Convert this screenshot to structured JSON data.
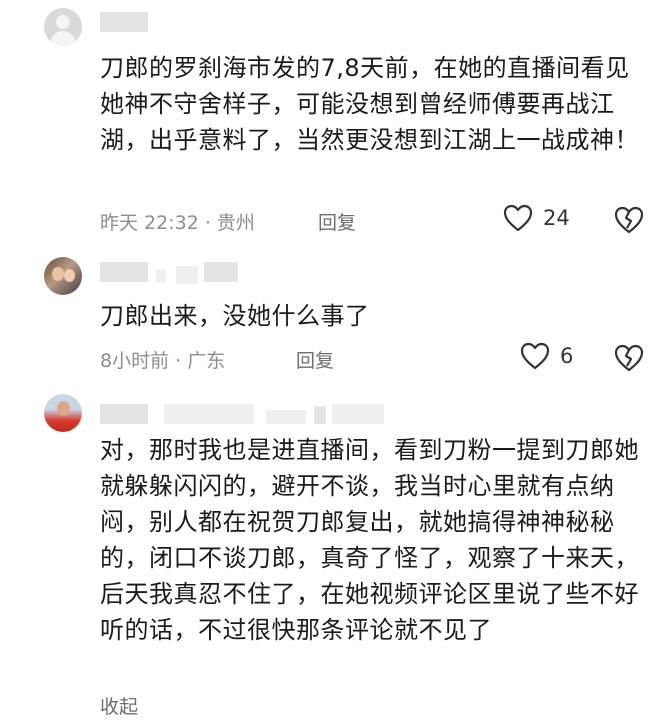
{
  "comments": [
    {
      "text": "刀郎的罗刹海市发的7,8天前，在她的直播间看见她神不守舍样子，可能没想到曾经师傅要再战江湖，出乎意料了，当然更没想到江湖上一战成神！",
      "meta": "昨天 22:32 · 贵州",
      "reply_label": "回复",
      "like_count": "24"
    },
    {
      "text": "刀郎出来，没她什么事了",
      "meta": "8小时前 · 广东",
      "reply_label": "回复",
      "like_count": "6"
    },
    {
      "text": "对，那时我也是进直播间，看到刀粉一提到刀郎她就躲躲闪闪的，避开不谈，我当时心里就有点纳闷，别人都在祝贺刀郎复出，就她搞得神神秘秘的，闭口不谈刀郎，真奇了怪了，观察了十来天，后天我真忍不住了，在她视频评论区里说了些不好听的话，不过很快那条评论就不见了",
      "collapse_label": "收起"
    }
  ],
  "icons": {
    "like": "heart-outline-icon",
    "dislike": "broken-heart-icon",
    "avatar": "default-avatar-icon"
  },
  "colors": {
    "text": "#1b1b1b",
    "meta": "#8d8d8d",
    "reply": "#6e6e6e",
    "icon": "#333333"
  }
}
